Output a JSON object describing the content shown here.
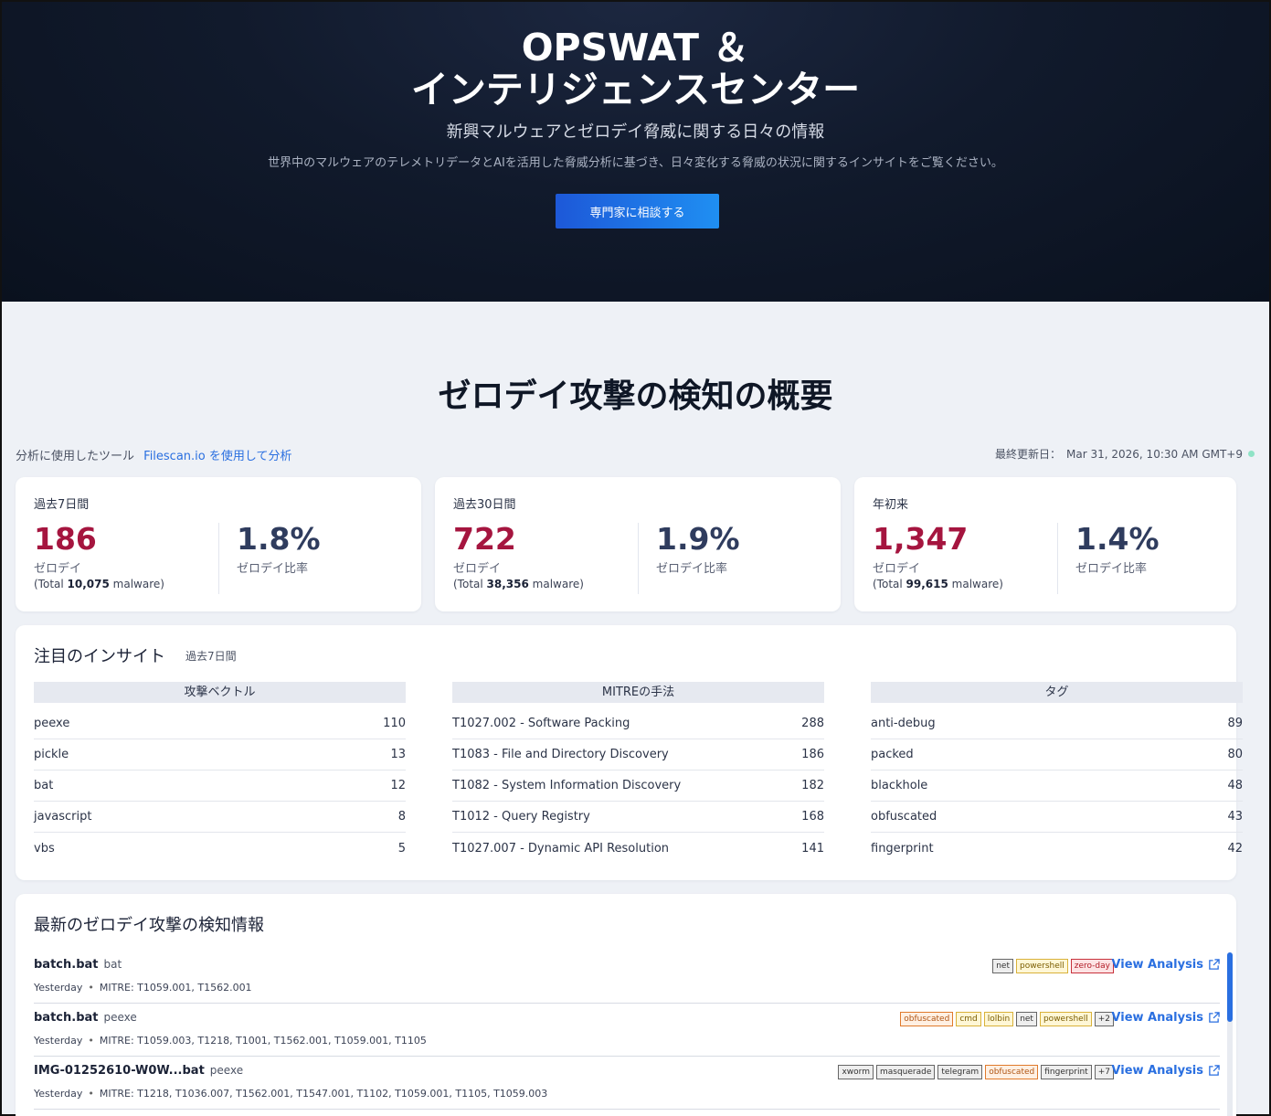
{
  "hero": {
    "title_line1": "OPSWAT ＆",
    "title_line2": "インテリジェンスセンター",
    "subtitle": "新興マルウェアとゼロデイ脅威に関する日々の情報",
    "description": "世界中のマルウェアのテレメトリデータとAIを活用した脅威分析に基づき、日々変化する脅威の状況に関するインサイトをご覧ください。",
    "cta_label": "専門家に相談する"
  },
  "overview": {
    "title": "ゼロデイ攻撃の検知の概要",
    "tool_prefix": "分析に使用したツール",
    "tool_link": "Filescan.io を使用して分析",
    "updated_label": "最終更新日：",
    "updated_value": "Mar 31, 2026, 10:30 AM GMT+9"
  },
  "stats": [
    {
      "label": "過去7日間",
      "count": "186",
      "count_label": "ゼロデイ",
      "total_prefix": "(Total ",
      "total_value": "10,075",
      "total_suffix": " malware)",
      "rate": "1.8%",
      "rate_label": "ゼロデイ比率"
    },
    {
      "label": "過去30日間",
      "count": "722",
      "count_label": "ゼロデイ",
      "total_prefix": "(Total ",
      "total_value": "38,356",
      "total_suffix": " malware)",
      "rate": "1.9%",
      "rate_label": "ゼロデイ比率"
    },
    {
      "label": "年初来",
      "count": "1,347",
      "count_label": "ゼロデイ",
      "total_prefix": "(Total ",
      "total_value": "99,615",
      "total_suffix": " malware)",
      "rate": "1.4%",
      "rate_label": "ゼロデイ比率"
    }
  ],
  "insights": {
    "title": "注目のインサイト",
    "period": "過去7日間",
    "columns": [
      {
        "header": "攻撃ベクトル",
        "rows": [
          {
            "name": "peexe",
            "value": "110"
          },
          {
            "name": "pickle",
            "value": "13"
          },
          {
            "name": "bat",
            "value": "12"
          },
          {
            "name": "javascript",
            "value": "8"
          },
          {
            "name": "vbs",
            "value": "5"
          }
        ]
      },
      {
        "header": "MITREの手法",
        "rows": [
          {
            "name": "T1027.002 - Software Packing",
            "value": "288"
          },
          {
            "name": "T1083 - File and Directory Discovery",
            "value": "186"
          },
          {
            "name": "T1082 - System Information Discovery",
            "value": "182"
          },
          {
            "name": "T1012 - Query Registry",
            "value": "168"
          },
          {
            "name": "T1027.007 - Dynamic API Resolution",
            "value": "141"
          }
        ]
      },
      {
        "header": "タグ",
        "rows": [
          {
            "name": "anti-debug",
            "value": "89"
          },
          {
            "name": "packed",
            "value": "80"
          },
          {
            "name": "blackhole",
            "value": "48"
          },
          {
            "name": "obfuscated",
            "value": "43"
          },
          {
            "name": "fingerprint",
            "value": "42"
          }
        ]
      }
    ]
  },
  "latest": {
    "title": "最新のゼロデイ攻撃の検知情報",
    "view_label": "View Analysis",
    "items": [
      {
        "name": "batch.bat",
        "type": "bat",
        "when": "Yesterday",
        "mitre": "MITRE: T1059.001, T1562.001",
        "tags": [
          {
            "text": "net",
            "style": "gray"
          },
          {
            "text": "powershell",
            "style": "yellow"
          },
          {
            "text": "zero-day",
            "style": "red"
          }
        ]
      },
      {
        "name": "batch.bat",
        "type": "peexe",
        "when": "Yesterday",
        "mitre": "MITRE: T1059.003, T1218, T1001, T1562.001, T1059.001, T1105",
        "tags": [
          {
            "text": "obfuscated",
            "style": "orange"
          },
          {
            "text": "cmd",
            "style": "yellow"
          },
          {
            "text": "lolbin",
            "style": "yellow"
          },
          {
            "text": "net",
            "style": "gray"
          },
          {
            "text": "powershell",
            "style": "yellow"
          },
          {
            "text": "+2",
            "style": "gray"
          }
        ]
      },
      {
        "name": "IMG-01252610-W0W...bat",
        "type": "peexe",
        "when": "Yesterday",
        "mitre": "MITRE: T1218, T1036.007, T1562.001, T1547.001, T1102, T1059.001, T1105, T1059.003",
        "tags": [
          {
            "text": "xworm",
            "style": "gray"
          },
          {
            "text": "masquerade",
            "style": "gray"
          },
          {
            "text": "telegram",
            "style": "gray"
          },
          {
            "text": "obfuscated",
            "style": "orange"
          },
          {
            "text": "fingerprint",
            "style": "gray"
          },
          {
            "text": "+7",
            "style": "gray"
          }
        ]
      }
    ]
  }
}
